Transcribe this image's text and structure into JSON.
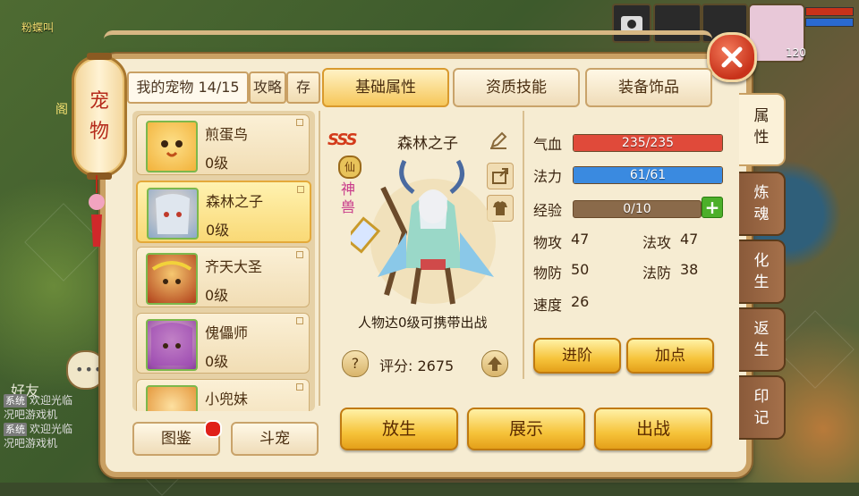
{
  "background": {
    "top_left_text": "粉蝶叫",
    "left_marker": "阁",
    "friends_label": "好友",
    "chat_lines": [
      {
        "tag": "系统",
        "text": "欢迎光临"
      },
      {
        "tag": "",
        "text": "况吧游戏机"
      },
      {
        "tag": "系统",
        "text": "欢迎光临"
      },
      {
        "tag": "",
        "text": "况吧游戏机"
      }
    ],
    "chat_icon": "chat-bubble-icon",
    "hud_level": "120"
  },
  "lantern": {
    "title": "宠物"
  },
  "header": {
    "my_pets_label": "我的宠物",
    "pet_count": "14/15",
    "guide_button": "攻略",
    "store_button": "存",
    "tabs": [
      {
        "label": "基础属性",
        "active": true
      },
      {
        "label": "资质技能",
        "active": false
      },
      {
        "label": "装备饰品",
        "active": false
      }
    ]
  },
  "pets": [
    {
      "name": "煎蛋鸟",
      "level": "0级",
      "selected": false,
      "color": "#f7c244"
    },
    {
      "name": "森林之子",
      "level": "0级",
      "selected": true,
      "color": "#9ab8d8"
    },
    {
      "name": "齐天大圣",
      "level": "0级",
      "selected": false,
      "color": "#e8a53a"
    },
    {
      "name": "傀儡师",
      "level": "0级",
      "selected": false,
      "color": "#b65ac2"
    },
    {
      "name": "小兜妹",
      "level": "",
      "selected": false,
      "color": "#f0a040"
    }
  ],
  "bottom_left": {
    "handbook_button": "图鉴",
    "fight_button": "斗宠"
  },
  "detail": {
    "rank": "SSS",
    "pet_name": "森林之子",
    "badge_xian": "仙",
    "badge_shenshou": "神兽",
    "carry_hint": "人物达0级可携带出战",
    "score_label": "评分:",
    "score_value": "2675",
    "icons": [
      "edit-icon",
      "share-icon",
      "shirt-icon",
      "help-icon",
      "upgrade-icon"
    ]
  },
  "stats": {
    "hp": {
      "label": "气血",
      "current": 235,
      "max": 235,
      "text": "235/235",
      "color": "#e04a3a"
    },
    "mp": {
      "label": "法力",
      "current": 61,
      "max": 61,
      "text": "61/61",
      "color": "#3a8ae0"
    },
    "exp": {
      "label": "经验",
      "current": 0,
      "max": 10,
      "text": "0/10",
      "color": "#8a6a4a"
    },
    "phys_atk_label": "物攻",
    "phys_atk": "47",
    "mag_atk_label": "法攻",
    "mag_atk": "47",
    "phys_def_label": "物防",
    "phys_def": "50",
    "mag_def_label": "法防",
    "mag_def": "38",
    "speed_label": "速度",
    "speed": "26",
    "advance_button": "进阶",
    "points_button": "加点"
  },
  "actions": {
    "release_button": "放生",
    "show_button": "展示",
    "battle_button": "出战"
  },
  "side_tabs": [
    {
      "label": "属性",
      "active": true
    },
    {
      "label": "炼魂",
      "active": false
    },
    {
      "label": "化生",
      "active": false
    },
    {
      "label": "返生",
      "active": false
    },
    {
      "label": "印记",
      "active": false
    }
  ]
}
